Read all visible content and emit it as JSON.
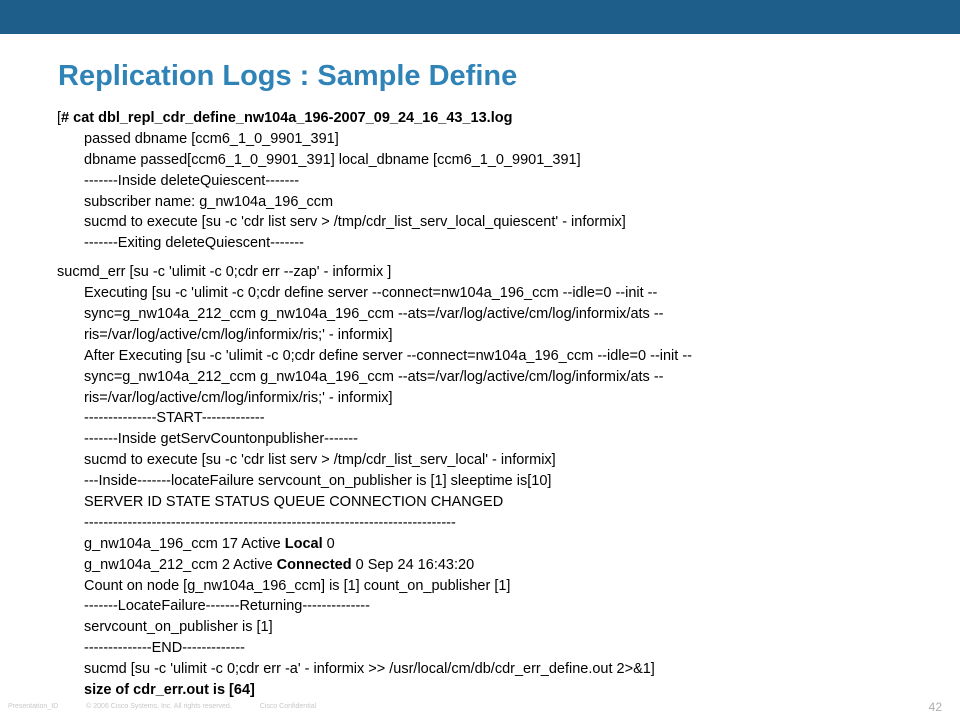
{
  "slide": {
    "title": "Replication Logs : Sample Define",
    "page_number": "42",
    "colors": {
      "top_bar": "#1d5f8a",
      "title": "#2f83b6"
    }
  },
  "log": {
    "header": "[# cat dbl_repl_cdr_define_nw104a_196-2007_09_24_16_43_13.log",
    "block1": [
      "passed dbname [ccm6_1_0_9901_391]",
      "dbname passed[ccm6_1_0_9901_391] local_dbname [ccm6_1_0_9901_391]",
      "-------Inside deleteQuiescent-------",
      "subscriber name: g_nw104a_196_ccm",
      "sucmd to execute [su -c 'cdr list serv > /tmp/cdr_list_serv_local_quiescent' - informix]",
      "-------Exiting deleteQuiescent-------"
    ],
    "sucmd_err": "sucmd_err [su -c 'ulimit -c 0;cdr err --zap' - informix ]",
    "block2": [
      "Executing [su -c 'ulimit -c 0;cdr define server --connect=nw104a_196_ccm --idle=0 --init --",
      "sync=g_nw104a_212_ccm g_nw104a_196_ccm --ats=/var/log/active/cm/log/informix/ats --",
      "ris=/var/log/active/cm/log/informix/ris;' - informix]",
      "After Executing [su -c 'ulimit -c 0;cdr define server --connect=nw104a_196_ccm --idle=0 --init --",
      "sync=g_nw104a_212_ccm g_nw104a_196_ccm --ats=/var/log/active/cm/log/informix/ats --",
      "ris=/var/log/active/cm/log/informix/ris;' - informix]",
      "---------------START-------------",
      "-------Inside getServCountonpublisher-------",
      "sucmd to execute [su -c 'cdr list serv > /tmp/cdr_list_serv_local' - informix]",
      "---Inside-------locateFailure servcount_on_publisher is [1] sleeptime is[10]",
      "SERVER ID STATE STATUS QUEUE CONNECTION CHANGED",
      "-----------------------------------------------------------------------------"
    ],
    "row1": {
      "prefix": "g_nw104a_196_ccm 17 Active ",
      "emphasis": "Local",
      "suffix": " 0"
    },
    "row2": {
      "prefix": "g_nw104a_212_ccm 2 Active ",
      "emphasis": "Connected",
      "suffix": " 0 Sep 24 16:43:20"
    },
    "block3": [
      "Count on node [g_nw104a_196_ccm] is [1] count_on_publisher [1]",
      "-------LocateFailure-------Returning--------------",
      "servcount_on_publisher is [1]",
      "--------------END-------------",
      "sucmd [su -c 'ulimit -c 0;cdr err -a' - informix >> /usr/local/cm/db/cdr_err_define.out 2>&1]"
    ],
    "last_line": "size of cdr_err.out is [64]"
  },
  "footer": {
    "presentation": "Presentation_ID",
    "rights": "© 2006 Cisco Systems, Inc. All rights reserved.",
    "confidential": "Cisco Confidential"
  }
}
